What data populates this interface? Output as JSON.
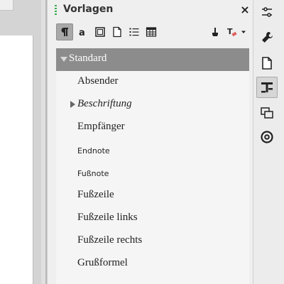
{
  "deck": {
    "title": "Vorlagen",
    "close_label": "×"
  },
  "toolbar": {
    "buttons": [
      {
        "icon": "paragraph-styles-icon"
      },
      {
        "icon": "character-styles-icon"
      },
      {
        "icon": "frame-styles-icon"
      },
      {
        "icon": "page-styles-icon"
      },
      {
        "icon": "list-styles-icon"
      },
      {
        "icon": "table-styles-icon"
      },
      {
        "icon": "fill-format-mode-icon"
      },
      {
        "icon": "new-style-icon"
      }
    ],
    "active_index": 0
  },
  "styles": {
    "items": [
      {
        "label": "Standard",
        "selected": true,
        "expanded": true
      },
      {
        "label": "Absender"
      },
      {
        "label": "Beschriftung",
        "collapsed_children": true
      },
      {
        "label": "Empfänger"
      },
      {
        "label": "Endnote"
      },
      {
        "label": "Fußnote"
      },
      {
        "label": "Fußzeile"
      },
      {
        "label": "Fußzeile links"
      },
      {
        "label": "Fußzeile rechts"
      },
      {
        "label": "Grußformel"
      }
    ]
  },
  "tabbar": {
    "tabs": [
      {
        "icon": "sidebar-settings-icon"
      },
      {
        "icon": "properties-wrench-icon"
      },
      {
        "icon": "page-icon"
      },
      {
        "icon": "styles-icon",
        "active": true
      },
      {
        "icon": "gallery-icon"
      },
      {
        "icon": "navigator-icon"
      }
    ]
  },
  "colors": {
    "selected_row": "#8c8c8c",
    "active_button": "#a8a8a8",
    "grip_green": "#3dab4d"
  }
}
